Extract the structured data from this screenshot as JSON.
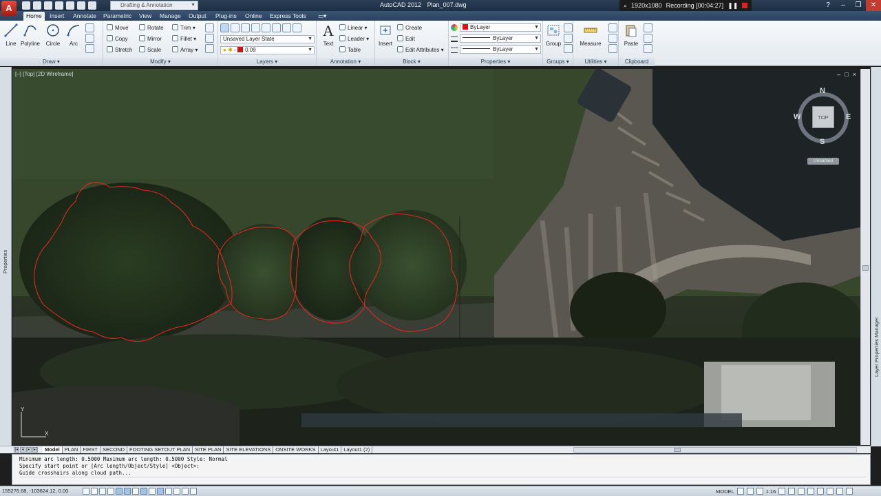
{
  "app": {
    "logo_letter": "A",
    "title": "AutoCAD 2012",
    "filename": "Plan_007.dwg",
    "workspace": "Drafting & Annotation"
  },
  "recorder": {
    "resolution": "1920x1080",
    "status": "Recording [00:04:27]"
  },
  "ribbon_tabs": [
    {
      "label": "Home",
      "active": true
    },
    {
      "label": "Insert"
    },
    {
      "label": "Annotate"
    },
    {
      "label": "Parametric"
    },
    {
      "label": "View"
    },
    {
      "label": "Manage"
    },
    {
      "label": "Output"
    },
    {
      "label": "Plug-ins"
    },
    {
      "label": "Online"
    },
    {
      "label": "Express Tools"
    }
  ],
  "draw_panel": {
    "title": "Draw",
    "tools": [
      "Line",
      "Polyline",
      "Circle",
      "Arc"
    ]
  },
  "modify_panel": {
    "title": "Modify",
    "tools": [
      "Move",
      "Rotate",
      "Trim",
      "Copy",
      "Mirror",
      "Fillet",
      "Stretch",
      "Scale",
      "Array"
    ]
  },
  "layers_panel": {
    "title": "Layers",
    "layer_state": "Unsaved Layer State",
    "current_layer": "0.09"
  },
  "annotation_panel": {
    "title": "Annotation",
    "text_tool": "Text",
    "tools": [
      "Linear",
      "Leader",
      "Table"
    ]
  },
  "block_panel": {
    "title": "Block",
    "insert_tool": "Insert",
    "tools": [
      "Create",
      "Edit",
      "Edit Attributes"
    ]
  },
  "properties_panel": {
    "title": "Properties",
    "color": "ByLayer",
    "linetype": "ByLayer",
    "lineweight": "ByLayer"
  },
  "groups_panel": {
    "title": "Groups",
    "tool": "Group"
  },
  "utilities_panel": {
    "title": "Utilities",
    "tool": "Measure"
  },
  "clipboard_panel": {
    "title": "Clipboard",
    "tool": "Paste"
  },
  "viewport": {
    "label": "[–] [Top] [2D Wireframe]",
    "controls": [
      "–",
      "□",
      "×"
    ]
  },
  "viewcube": {
    "face": "TOP",
    "north": "N",
    "south": "S",
    "east": "E",
    "west": "W",
    "ucs_name": "Unnamed"
  },
  "ucs_icon": {
    "x_label": "X",
    "y_label": "Y"
  },
  "palettes": {
    "left": "Properties",
    "right": "Layer Properties Manager"
  },
  "layout_tabs": [
    {
      "label": "Model",
      "active": true
    },
    {
      "label": "PLAN"
    },
    {
      "label": "FIRST"
    },
    {
      "label": "SECOND"
    },
    {
      "label": "FOOTING SETOUT PLAN"
    },
    {
      "label": "SITE PLAN"
    },
    {
      "label": "SITE ELEVATIONS"
    },
    {
      "label": "ONSITE WORKS"
    },
    {
      "label": "Layout1"
    },
    {
      "label": "Layout1 (2)"
    }
  ],
  "command_history": [
    "Minimum arc length: 0.5000   Maximum arc length: 0.5000   Style: Normal",
    "Specify start point or [Arc length/Object/Style] <Object>:",
    "Guide crosshairs along cloud path..."
  ],
  "statusbar": {
    "coordinates": "155276.68, -103624.12, 0.00",
    "space": "MODEL",
    "annotation_scale": "1:16"
  },
  "colors": {
    "revcloud": "#e0281e",
    "bylayer_swatch": "#e01010",
    "ribbon_tab_bg": "#2b4260"
  }
}
